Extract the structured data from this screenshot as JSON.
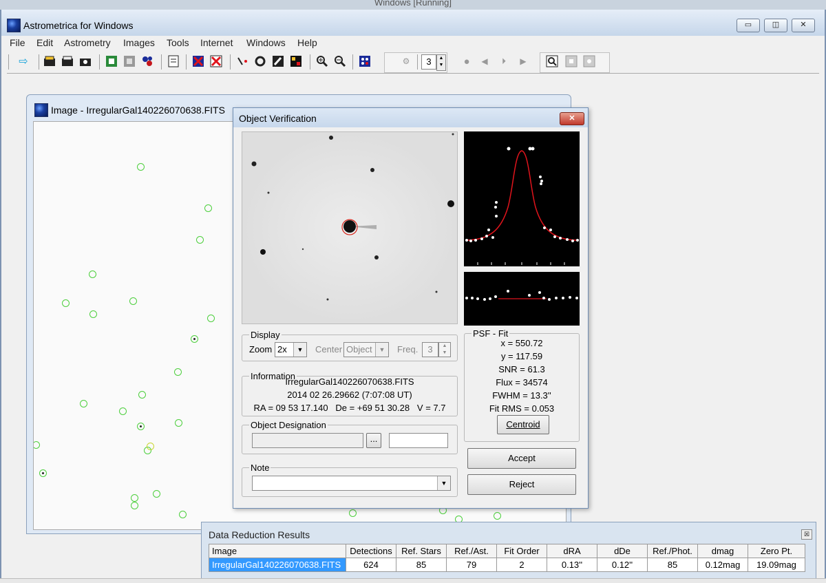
{
  "host": {
    "title": "Windows [Running]"
  },
  "app": {
    "title": "Astrometrica for Windows",
    "menu": [
      "File",
      "Edit",
      "Astrometry",
      "Images",
      "Tools",
      "Internet",
      "Windows",
      "Help"
    ],
    "toolbar": {
      "spin_value": "3"
    },
    "caption_buttons": {
      "minimize": "▭",
      "restore": "◫",
      "close": "✕"
    }
  },
  "image_window": {
    "title": "Image - IrregularGal140226070638.FITS"
  },
  "dialog": {
    "title": "Object Verification",
    "close": "✕",
    "display": {
      "legend": "Display",
      "zoom_label": "Zoom",
      "zoom_value": "2x",
      "center_label": "Center",
      "center_value": "Object",
      "freq_label": "Freq.",
      "freq_value": "3"
    },
    "information": {
      "legend": "Information",
      "file": "IrregularGal140226070638.FITS",
      "date": "2014 02 26.29662 (7:07:08 UT)",
      "coords": "RA = 09 53 17.140   De = +69 51 30.28   V = 7.7"
    },
    "designation": {
      "legend": "Object Designation",
      "browse": "..."
    },
    "note": {
      "legend": "Note"
    },
    "psf": {
      "legend": "PSF - Fit",
      "x": "x = 550.72",
      "y": "y = 117.59",
      "snr": "SNR = 61.3",
      "flux": "Flux = 34574",
      "fwhm": "FWHM = 13.3''",
      "fit_rms": "Fit RMS = 0.053",
      "centroid": "Centroid"
    },
    "accept": "Accept",
    "reject": "Reject"
  },
  "results": {
    "title": "Data Reduction Results",
    "close": "☒",
    "columns": [
      "Image",
      "Detections",
      "Ref. Stars",
      "Ref./Ast.",
      "Fit Order",
      "dRA",
      "dDe",
      "Ref./Phot.",
      "dmag",
      "Zero Pt."
    ],
    "row": [
      "IrregularGal140226070638.FITS",
      "624",
      "85",
      "79",
      "2",
      "0.13''",
      "0.12''",
      "85",
      "0.12mag",
      "19.09mag"
    ]
  }
}
